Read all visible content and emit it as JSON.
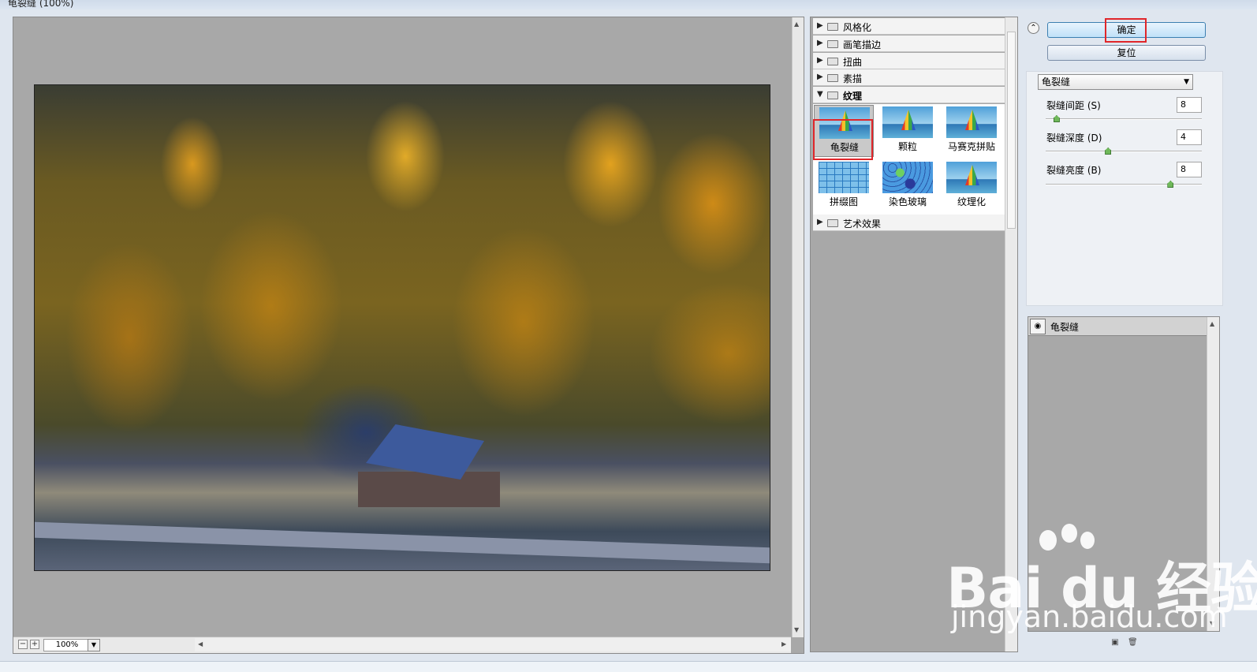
{
  "window": {
    "title": "龟裂缝 (100%)"
  },
  "preview": {
    "zoom_value": "100%"
  },
  "gallery": {
    "categories": [
      {
        "label": "风格化",
        "expanded": false
      },
      {
        "label": "画笔描边",
        "expanded": false
      },
      {
        "label": "扭曲",
        "expanded": false
      },
      {
        "label": "素描",
        "expanded": false
      },
      {
        "label": "纹理",
        "expanded": true
      },
      {
        "label": "艺术效果",
        "expanded": false
      }
    ],
    "texture_filters": [
      {
        "label": "龟裂缝",
        "selected": true,
        "icon": "sailboat-cracked-thumb"
      },
      {
        "label": "颗粒",
        "selected": false,
        "icon": "sailboat-grain-thumb"
      },
      {
        "label": "马赛克拼贴",
        "selected": false,
        "icon": "sailboat-mosaic-tiles-thumb"
      },
      {
        "label": "拼缀图",
        "selected": false,
        "icon": "patchwork-thumb"
      },
      {
        "label": "染色玻璃",
        "selected": false,
        "icon": "stained-glass-thumb"
      },
      {
        "label": "纹理化",
        "selected": false,
        "icon": "sailboat-texturizer-thumb"
      }
    ]
  },
  "settings": {
    "ok_label": "确定",
    "reset_label": "复位",
    "filter_select_value": "龟裂缝",
    "params": [
      {
        "label": "裂缝间距 (S)",
        "value": "8",
        "slider_fraction": 0.07
      },
      {
        "label": "裂缝深度 (D)",
        "value": "4",
        "slider_fraction": 0.4
      },
      {
        "label": "裂缝亮度 (B)",
        "value": "8",
        "slider_fraction": 0.8
      }
    ]
  },
  "layers": {
    "items": [
      {
        "label": "龟裂缝"
      }
    ]
  },
  "watermark": {
    "logo_text": "Bai du 经验",
    "url": "jingyan.baidu.com"
  },
  "colors": {
    "highlight_box": "#e0262a",
    "panel_gray": "#a8a8a8",
    "slider_knob": "#6fb85a"
  }
}
